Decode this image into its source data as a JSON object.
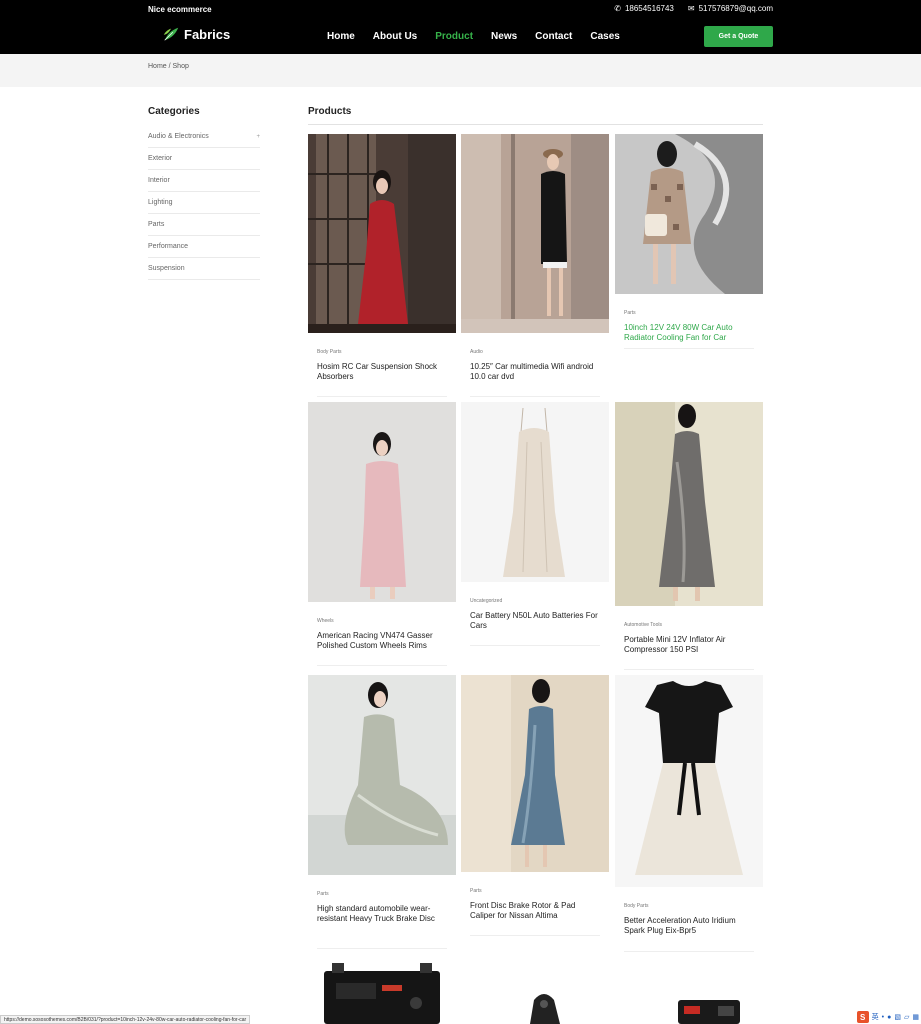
{
  "header": {
    "site_name": "Nice ecommerce",
    "phone": "18654516743",
    "email": "517576879@qq.com",
    "logo_text": "Fabrics",
    "nav": [
      "Home",
      "About Us",
      "Product",
      "News",
      "Contact",
      "Cases"
    ],
    "active_nav": "Product",
    "quote_label": "Get a Quote",
    "accent": "#2fa84a"
  },
  "breadcrumb": "Home / Shop",
  "sidebar": {
    "title": "Categories",
    "items": [
      "Audio & Electronics",
      "Exterior",
      "Interior",
      "Lighting",
      "Parts",
      "Performance",
      "Suspension"
    ]
  },
  "products": {
    "title": "Products",
    "items": [
      {
        "category": "Body Parts",
        "name": "Hosim RC Car Suspension Shock Absorbers",
        "image": "woman in red dress"
      },
      {
        "category": "Audio",
        "name": "10.25″ Car multimedia Wifi android 10.0 car dvd",
        "image": "woman in black dress"
      },
      {
        "category": "Parts",
        "name": "10inch 12V 24V 80W Car Auto Radiator Cooling Fan for Car",
        "image": "woman in checked dress"
      },
      {
        "category": "Wheels",
        "name": "American Racing VN474 Gasser Polished Custom Wheels Rims",
        "image": "woman in pink dress"
      },
      {
        "category": "Uncategorized",
        "name": "Car Battery N50L Auto Batteries For Cars",
        "image": "champagne slip dress"
      },
      {
        "category": "Automotive Tools",
        "name": "Portable Mini 12V Inflator Air Compressor 150 PSI",
        "image": "woman in grey slip dress"
      },
      {
        "category": "Parts",
        "name": "High standard automobile wear-resistant Heavy Truck Brake Disc",
        "image": "woman seated in sage dress"
      },
      {
        "category": "Parts",
        "name": "Front Disc Brake Rotor & Pad Caliper for Nissan Altima",
        "image": "woman in blue slip dress"
      },
      {
        "category": "Body Parts",
        "name": "Better Acceleration Auto Iridium Spark Plug Eix-Bpr5",
        "image": "black and white dress"
      }
    ]
  },
  "status_url": "https://demo.sososothemes.com/B2B/031/?product=10inch-12v-24v-80w-car-auto-radiator-cooling-fan-for-car",
  "tray": {
    "logo": "S",
    "label": "英"
  }
}
